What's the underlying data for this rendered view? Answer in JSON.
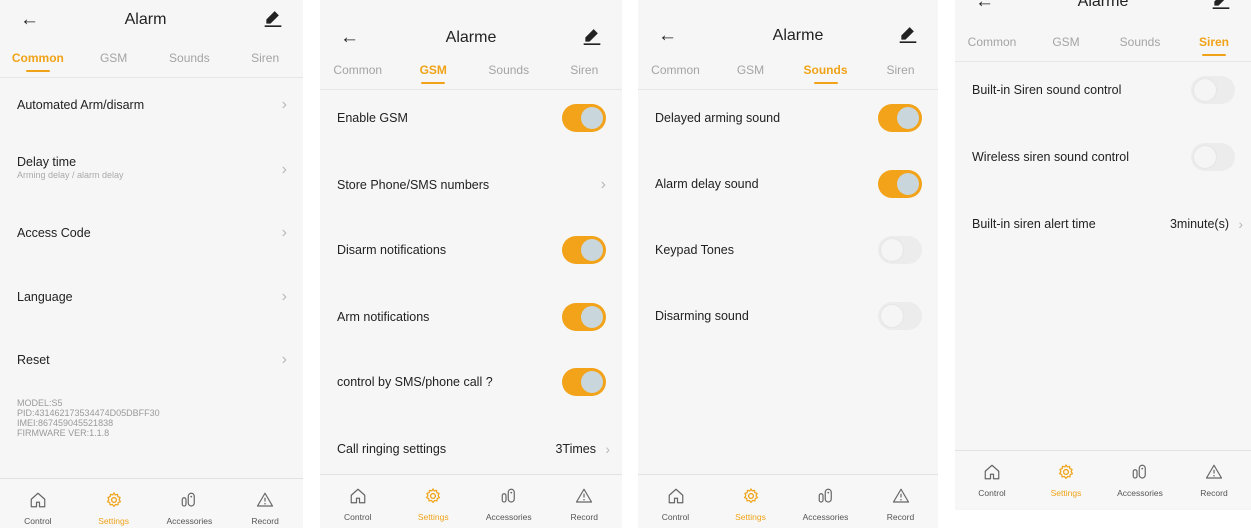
{
  "colors": {
    "accent": "#f0a318",
    "toggle_on": "#f2a31a",
    "knob_on": "#c9d7dc",
    "toggle_off": "#ececec"
  },
  "icons": {
    "back": "arrow-left-icon",
    "edit": "pencil-icon",
    "home": "home-icon",
    "settings": "gear-icon",
    "accessories": "sensor-icon",
    "record": "warning-triangle-icon",
    "chevron": "chevron-right-icon"
  },
  "tabs": [
    "Common",
    "GSM",
    "Sounds",
    "Siren"
  ],
  "bottom_nav": [
    "Control",
    "Settings",
    "Accessories",
    "Record"
  ],
  "panel1": {
    "title": "Alarm",
    "active_tab": "Common",
    "rows": [
      {
        "label": "Automated Arm/disarm"
      },
      {
        "label": "Delay time",
        "sublabel": "Arming delay / alarm delay"
      },
      {
        "label": "Access Code"
      },
      {
        "label": "Language"
      },
      {
        "label": "Reset"
      }
    ],
    "model_info": [
      "MODEL:S5",
      "PID:431462173534474D05DBFF30",
      "IMEI:867459045521838",
      "FIRMWARE VER:1.1.8"
    ]
  },
  "panel2": {
    "title": "Alarme",
    "active_tab": "GSM",
    "rows": [
      {
        "label": "Enable GSM",
        "toggle": "on"
      },
      {
        "label": "Store Phone/SMS numbers"
      },
      {
        "label": "Disarm notifications",
        "toggle": "on"
      },
      {
        "label": "Arm notifications",
        "toggle": "on"
      },
      {
        "label": "control by SMS/phone call ?",
        "toggle": "on"
      },
      {
        "label": "Call ringing settings",
        "value": "3Times"
      }
    ]
  },
  "panel3": {
    "title": "Alarme",
    "active_tab": "Sounds",
    "rows": [
      {
        "label": "Delayed arming sound",
        "toggle": "on"
      },
      {
        "label": "Alarm delay sound",
        "toggle": "on"
      },
      {
        "label": "Keypad Tones",
        "toggle": "off"
      },
      {
        "label": "Disarming sound",
        "toggle": "off"
      }
    ]
  },
  "panel4": {
    "title": "Alarme",
    "active_tab": "Siren",
    "rows": [
      {
        "label": "Built-in Siren sound control",
        "toggle": "off"
      },
      {
        "label": "Wireless siren sound control",
        "toggle": "off"
      },
      {
        "label": "Built-in siren alert time",
        "value": "3minute(s)"
      }
    ]
  }
}
